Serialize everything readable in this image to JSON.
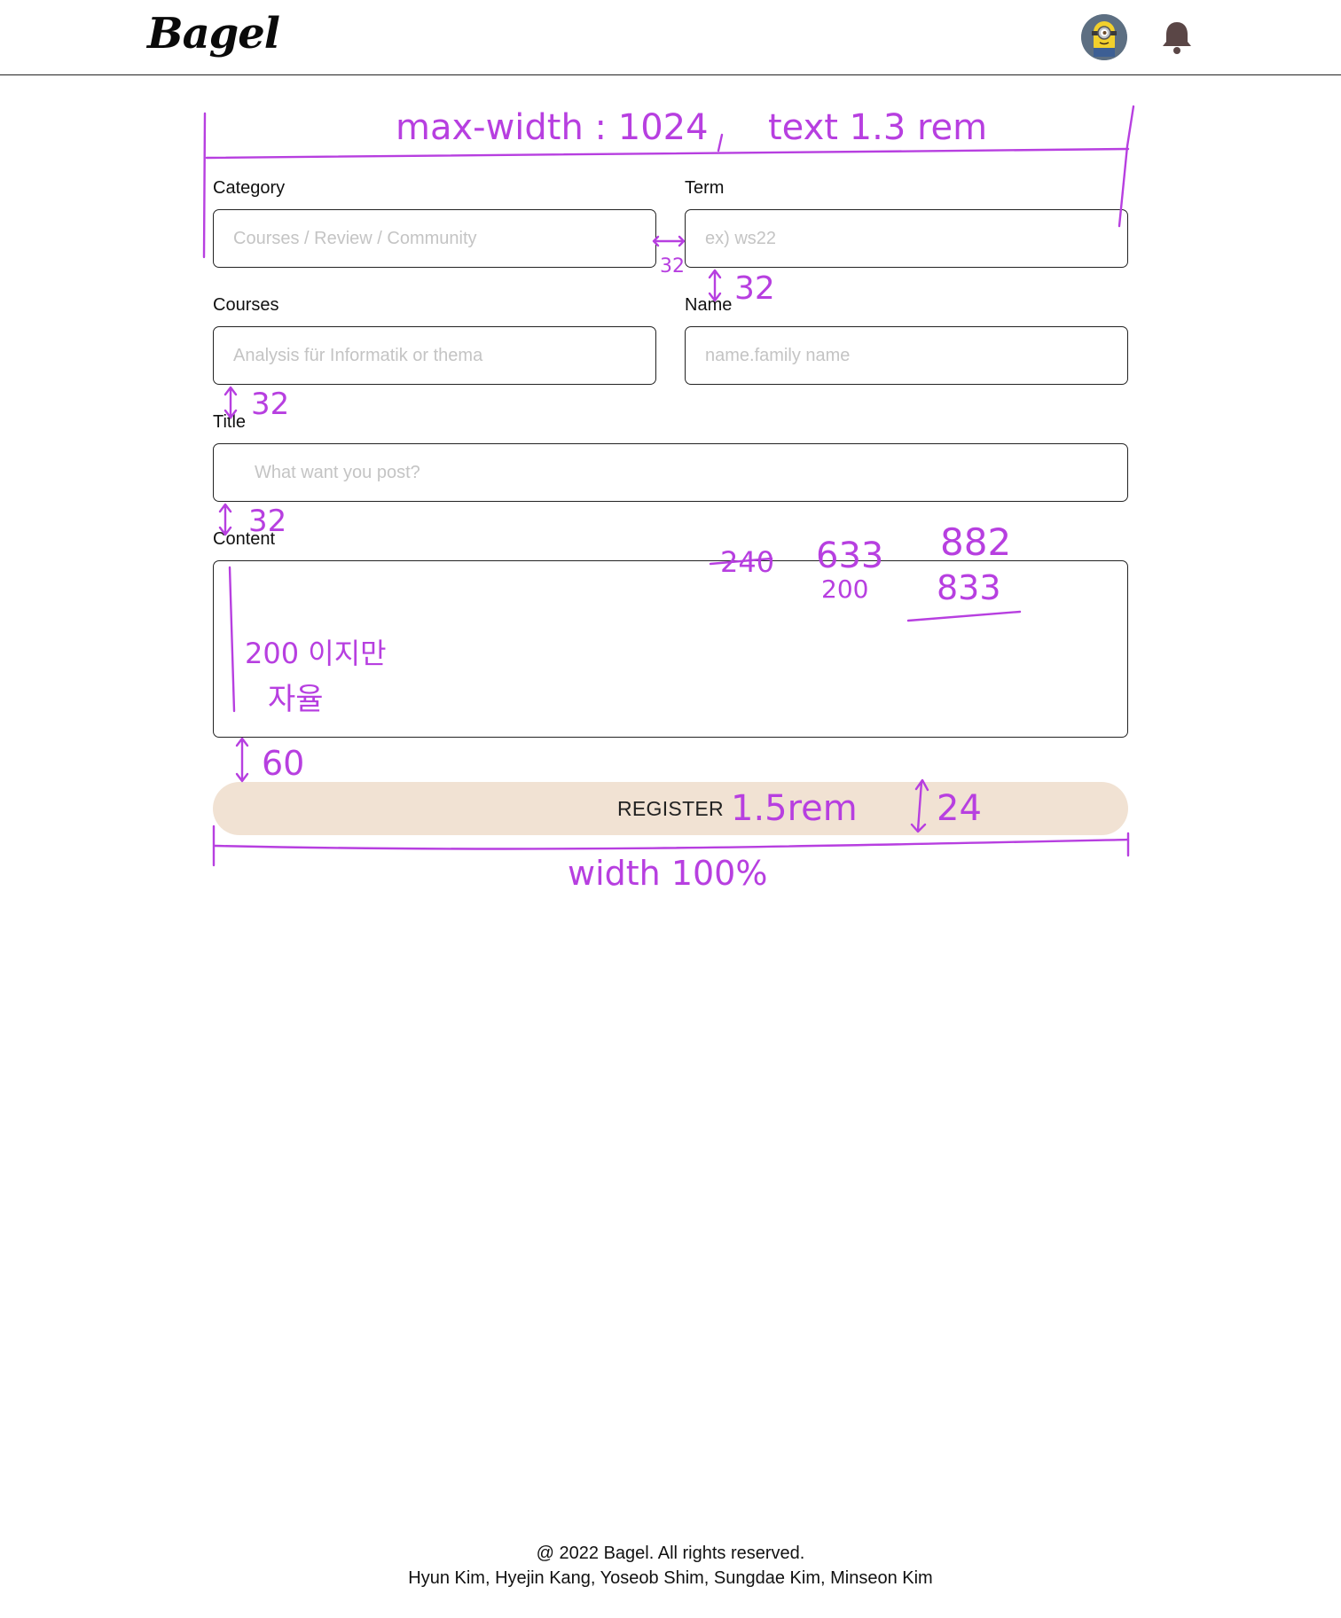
{
  "header": {
    "logo": "Bagel",
    "avatar_icon": "avatar-minion",
    "notification_icon": "bell-icon"
  },
  "form": {
    "category": {
      "label": "Category",
      "placeholder": "Courses / Review / Community"
    },
    "term": {
      "label": "Term",
      "placeholder": "ex) ws22"
    },
    "courses": {
      "label": "Courses",
      "placeholder": "Analysis für Informatik or thema"
    },
    "name": {
      "label": "Name",
      "placeholder": "name.family name"
    },
    "title": {
      "label": "Title",
      "placeholder": "What want you post?"
    },
    "content": {
      "label": "Content",
      "placeholder": ""
    },
    "register_label": "REGISTER"
  },
  "annotations": {
    "max_width": "max-width : 1024",
    "comma": ",",
    "text_size": "text 1.3 rem",
    "gap_h": "32",
    "gap_v1": "32",
    "gap_v2": "32",
    "gap_v3": "32",
    "struck": "240",
    "n633": "633",
    "n200": "200",
    "n882": "882",
    "n833": "833",
    "content_note_line1": "200 이지만",
    "content_note_line2": "자율",
    "gap_button": "60",
    "button_font": "1.5rem",
    "button_pad": "24",
    "button_width": "width 100%"
  },
  "colors": {
    "annotation": "#b73fe0",
    "button_bg": "#f1e2d3",
    "bell": "#5a4646"
  },
  "footer": {
    "line1": "@ 2022 Bagel. All rights reserved.",
    "line2": "Hyun Kim, Hyejin Kang, Yoseob Shim, Sungdae Kim, Minseon Kim"
  }
}
